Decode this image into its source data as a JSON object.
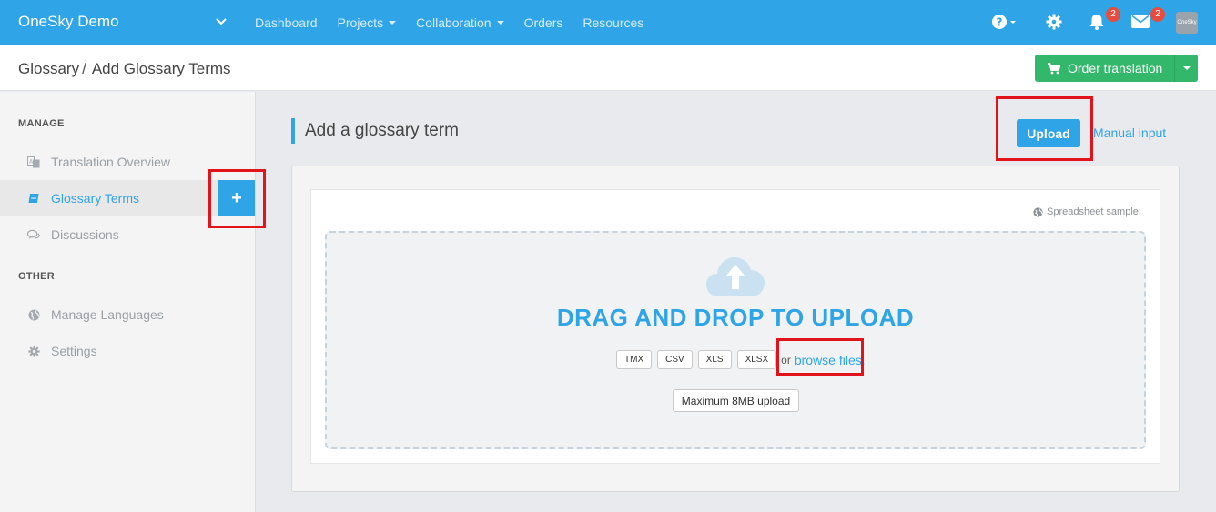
{
  "app": {
    "brand": "OneSky Demo"
  },
  "nav": {
    "links": [
      {
        "label": "Dashboard",
        "caret": false
      },
      {
        "label": "Projects",
        "caret": true
      },
      {
        "label": "Collaboration",
        "caret": true
      },
      {
        "label": "Orders",
        "caret": false
      },
      {
        "label": "Resources",
        "caret": false
      }
    ],
    "notifications_count": "2",
    "messages_count": "2",
    "avatar_text": "OneSky"
  },
  "header": {
    "breadcrumb_parent": "Glossary",
    "breadcrumb_sep": "/",
    "breadcrumb_current": "Add Glossary Terms",
    "order_label": "Order translation"
  },
  "sidebar": {
    "manage_label": "MANAGE",
    "other_label": "OTHER",
    "items": [
      {
        "label": "Translation Overview"
      },
      {
        "label": "Glossary Terms"
      },
      {
        "label": "Discussions"
      },
      {
        "label": "Manage Languages"
      },
      {
        "label": "Settings"
      }
    ],
    "plus_label": "+"
  },
  "main": {
    "title": "Add a glossary term",
    "upload_label": "Upload",
    "manual_label": "Manual input",
    "sample_label": "Spreadsheet sample",
    "dnd_text": "DRAG AND DROP TO UPLOAD",
    "formats": [
      "TMX",
      "CSV",
      "XLS",
      "XLSX"
    ],
    "or_text": "or",
    "browse_label": "browse files.",
    "max_upload": "Maximum 8MB upload"
  },
  "colors": {
    "primary": "#2fa4e7",
    "success": "#33b86b",
    "badge": "#e74c3c",
    "highlight": "#e1141b"
  }
}
